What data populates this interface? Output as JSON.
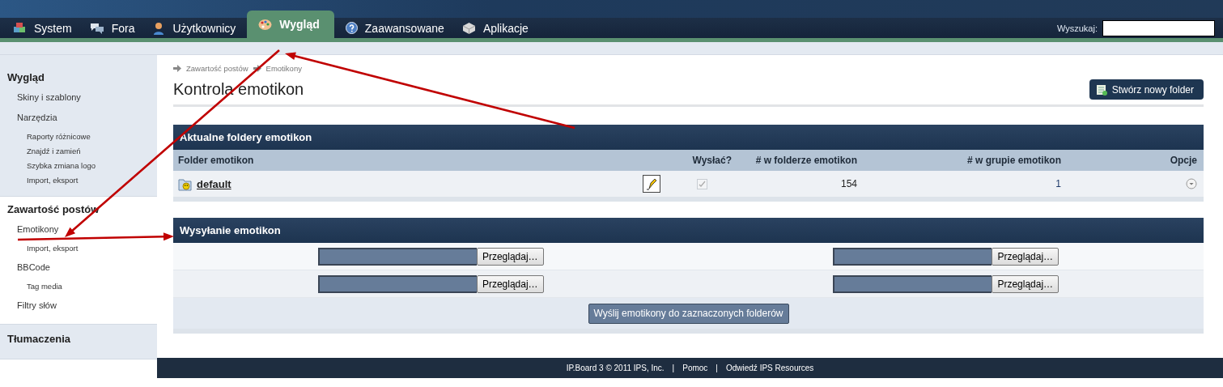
{
  "nav": {
    "tabs": [
      {
        "label": "System",
        "selected": false
      },
      {
        "label": "Fora",
        "selected": false
      },
      {
        "label": "Użytkownicy",
        "selected": false
      },
      {
        "label": "Wygląd",
        "selected": true
      },
      {
        "label": "Zaawansowane",
        "selected": false
      },
      {
        "label": "Aplikacje",
        "selected": false
      }
    ],
    "search": {
      "label": "Wyszukaj:"
    }
  },
  "sidebar": {
    "sections": [
      {
        "title": "Wygląd",
        "selected": false,
        "items": [
          {
            "label": "Skiny i szablony"
          },
          {
            "label": "Narzędzia",
            "children": [
              {
                "label": "Raporty różnicowe"
              },
              {
                "label": "Znajdź i zamień"
              },
              {
                "label": "Szybka zmiana logo"
              },
              {
                "label": "Import, eksport"
              }
            ]
          }
        ]
      },
      {
        "title": "Zawartość postów",
        "selected": true,
        "items": [
          {
            "label": "Emotikony",
            "children": [
              {
                "label": "Import, eksport"
              }
            ]
          },
          {
            "label": "BBCode",
            "children": [
              {
                "label": "Tag media"
              }
            ]
          },
          {
            "label": "Filtry słów"
          }
        ]
      },
      {
        "title": "Tłumaczenia",
        "selected": false
      }
    ]
  },
  "breadcrumb": [
    "Zawartość postów",
    "Emotikony"
  ],
  "page_title": "Kontrola emotikon",
  "new_folder_button": "Stwórz nowy folder",
  "folders": {
    "title": "Aktualne foldery emotikon",
    "columns": [
      "Folder emotikon",
      "Wysłać?",
      "# w folderze emotikon",
      "# w grupie emotikon",
      "Opcje"
    ],
    "rows": [
      {
        "name": "default",
        "checked": true,
        "count": "154",
        "group_count": "1"
      }
    ]
  },
  "upload": {
    "title": "Wysyłanie emotikon",
    "rows": [
      [
        "Przeglądaj…",
        "Przeglądaj…"
      ],
      [
        "Przeglądaj…",
        "Przeglądaj…"
      ]
    ],
    "submit": "Wyślij emotikony do zaznaczonych folderów"
  },
  "footer": {
    "items": [
      "IP.Board 3 © 2011 IPS, Inc.",
      "Pomoc",
      "Odwiedź IPS Resources"
    ],
    "separators": [
      "|",
      "|"
    ]
  }
}
